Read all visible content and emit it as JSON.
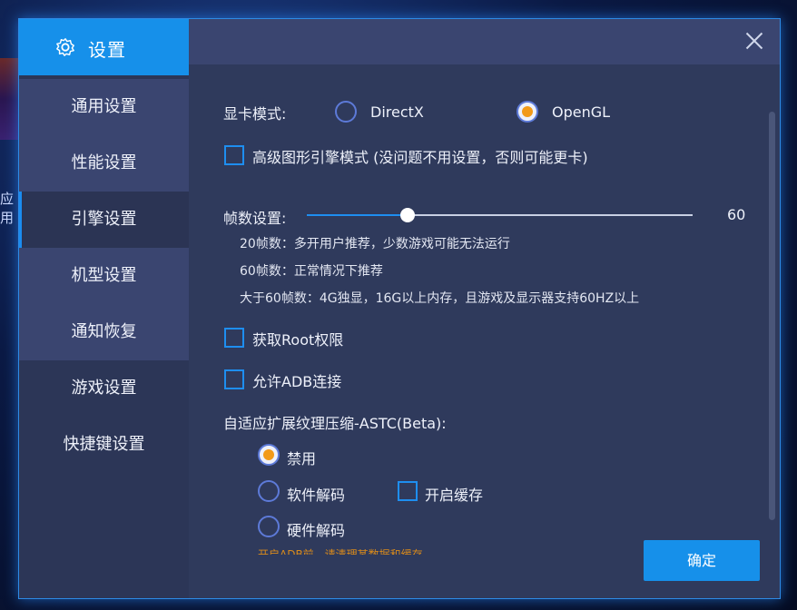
{
  "background": {
    "edge_text": "应用"
  },
  "dialog": {
    "accent_color": "#1690ea",
    "sidebar": {
      "header_icon": "gear-icon",
      "header_title": "设置",
      "items": [
        {
          "label": "通用设置"
        },
        {
          "label": "性能设置"
        },
        {
          "label": "引擎设置",
          "active": true
        },
        {
          "label": "机型设置"
        },
        {
          "label": "通知恢复"
        },
        {
          "label": "游戏设置"
        },
        {
          "label": "快捷键设置"
        }
      ]
    },
    "close_icon": "close-icon",
    "gpu_mode": {
      "label": "显卡模式:",
      "options": [
        {
          "label": "DirectX",
          "selected": false
        },
        {
          "label": "OpenGL",
          "selected": true
        }
      ]
    },
    "advanced_graphics": {
      "label": "高级图形引擎模式 (没问题不用设置，否则可能更卡)",
      "checked": false
    },
    "fps": {
      "label": "帧数设置:",
      "value": "60",
      "hints": [
        "20帧数：多开用户推荐，少数游戏可能无法运行",
        "60帧数：正常情况下推荐",
        "大于60帧数：4G独显，16G以上内存，且游戏及显示器支持60HZ以上"
      ]
    },
    "root": {
      "label": "获取Root权限",
      "checked": false
    },
    "adb": {
      "label": "允许ADB连接",
      "checked": false
    },
    "astc": {
      "label": "自适应扩展纹理压缩-ASTC(Beta):",
      "options": [
        {
          "label": "禁用",
          "selected": true
        },
        {
          "label": "软件解码",
          "selected": false
        },
        {
          "label": "硬件解码",
          "selected": false
        }
      ],
      "cache": {
        "label": "开启缓存",
        "checked": false
      },
      "warning_partial": "开启ADB前，请清理某数据和缓存"
    },
    "confirm_button": "确定"
  }
}
